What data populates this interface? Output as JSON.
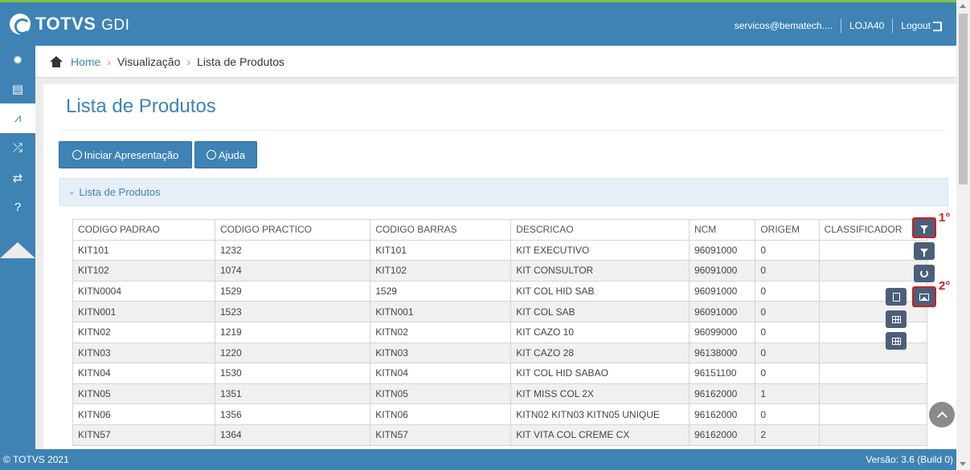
{
  "header": {
    "brand": "TOTVS",
    "brand_suffix": "GDI",
    "user": "servicos@bematech....",
    "store": "LOJA40",
    "logout": "Logout"
  },
  "breadcrumb": {
    "home": "Home",
    "level1": "Visualização",
    "level2": "Lista de Produtos"
  },
  "sidebar": {
    "items": [
      "gear-icon",
      "report-icon",
      "chart-icon",
      "shuffle-icon",
      "exchange-icon",
      "help-icon"
    ],
    "active_index": 2
  },
  "page": {
    "title": "Lista de Produtos"
  },
  "buttons": {
    "start": "Iniciar Apresentação",
    "help": "Ajuda"
  },
  "panel": {
    "title": "Lista de Produtos"
  },
  "table": {
    "columns": [
      "CODIGO PADRAO",
      "CODIGO PRACTICO",
      "CODIGO BARRAS",
      "DESCRICAO",
      "NCM",
      "ORIGEM",
      "CLASSIFICADOR"
    ],
    "rows": [
      [
        "KIT101",
        "1232",
        "KIT101",
        "KIT EXECUTIVO",
        "96091000",
        "0",
        ""
      ],
      [
        "KIT102",
        "1074",
        "KIT102",
        "KIT CONSULTOR",
        "96091000",
        "0",
        ""
      ],
      [
        "KITN0004",
        "1529",
        "1529",
        "KIT COL HID SAB",
        "96091000",
        "0",
        ""
      ],
      [
        "KITN001",
        "1523",
        "KITN001",
        "KIT COL SAB",
        "96091000",
        "0",
        ""
      ],
      [
        "KITN02",
        "1219",
        "KITN02",
        "KIT CAZO 10",
        "96099000",
        "0",
        ""
      ],
      [
        "KITN03",
        "1220",
        "KITN03",
        "KIT CAZO 28",
        "96138000",
        "0",
        ""
      ],
      [
        "KITN04",
        "1530",
        "KITN04",
        "KIT COL HID SABAO",
        "96151100",
        "0",
        ""
      ],
      [
        "KITN05",
        "1351",
        "KITN05",
        "KIT MISS COL 2X",
        "96162000",
        "1",
        ""
      ],
      [
        "KITN06",
        "1356",
        "KITN06",
        "KITN02 KITN03 KITN05 UNIQUE",
        "96162000",
        "0",
        ""
      ],
      [
        "KITN57",
        "1364",
        "KITN57",
        "KIT VITA COL CREME CX",
        "96162000",
        "2",
        ""
      ]
    ]
  },
  "annotations": {
    "step1": "1°",
    "step2": "2°"
  },
  "footer": {
    "copyright": "© TOTVS 2021",
    "version": "Versão: 3.6 (Build 0)"
  },
  "colors": {
    "primary": "#3e83b4",
    "accent": "#7dc242",
    "highlight": "#d61b1b",
    "tool": "#4c5f7a"
  }
}
